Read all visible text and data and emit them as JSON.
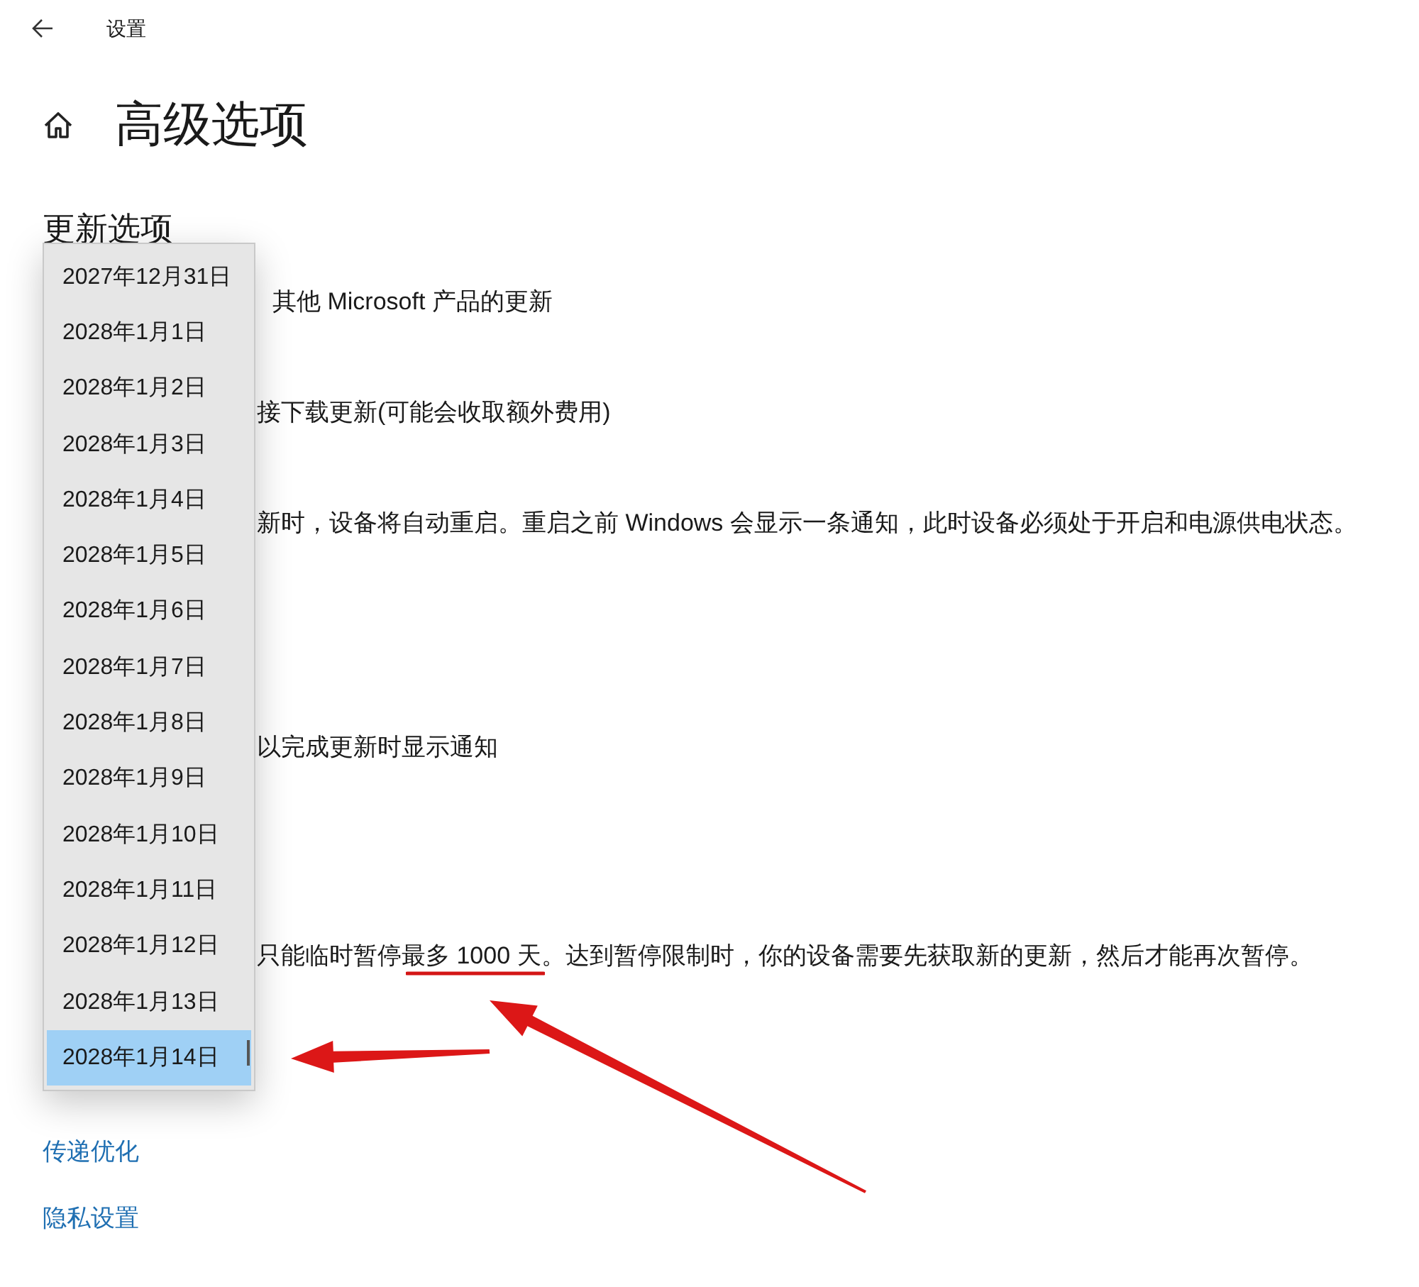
{
  "window": {
    "title": "设置"
  },
  "page": {
    "title": "高级选项"
  },
  "section": {
    "heading": "更新选项",
    "lines": [
      "其他 Microsoft 产品的更新",
      "接下载更新(可能会收取额外费用)",
      "新时，设备将自动重启。重启之前 Windows 会显示一条通知，此时设备必须处于开启和电源供电状态。",
      "以完成更新时显示通知",
      "只能临时暂停最多 1000 天。达到暂停限制时，你的设备需要先获取新的更新，然后才能再次暂停。"
    ]
  },
  "date_dropdown": {
    "options": [
      {
        "label": "2027年12月31日",
        "selected": false
      },
      {
        "label": "2028年1月1日",
        "selected": false
      },
      {
        "label": "2028年1月2日",
        "selected": false
      },
      {
        "label": "2028年1月3日",
        "selected": false
      },
      {
        "label": "2028年1月4日",
        "selected": false
      },
      {
        "label": "2028年1月5日",
        "selected": false
      },
      {
        "label": "2028年1月6日",
        "selected": false
      },
      {
        "label": "2028年1月7日",
        "selected": false
      },
      {
        "label": "2028年1月8日",
        "selected": false
      },
      {
        "label": "2028年1月9日",
        "selected": false
      },
      {
        "label": "2028年1月10日",
        "selected": false
      },
      {
        "label": "2028年1月11日",
        "selected": false
      },
      {
        "label": "2028年1月12日",
        "selected": false
      },
      {
        "label": "2028年1月13日",
        "selected": false
      },
      {
        "label": "2028年1月14日",
        "selected": true
      }
    ]
  },
  "links": [
    "传递优化",
    "隐私设置"
  ]
}
